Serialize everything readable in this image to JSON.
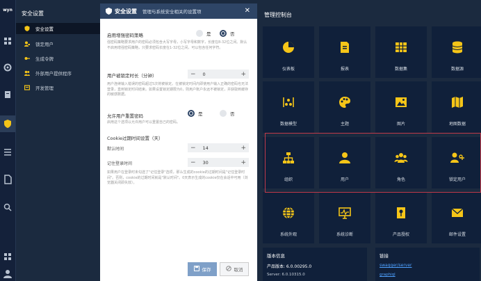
{
  "rail": {
    "logo": "wyn"
  },
  "sidebar": {
    "title": "安全设置",
    "items": [
      {
        "label": "安全设置"
      },
      {
        "label": "锁定用户"
      },
      {
        "label": "生成令牌"
      },
      {
        "label": "外部用户提供程序"
      },
      {
        "label": "开发管理"
      }
    ]
  },
  "dialog": {
    "title": "安全设置",
    "subtitle": "管理与系统安全相关的设置项",
    "close_glyph": "✕",
    "strict_password": {
      "label": "启用增强密码策略",
      "option_yes": "是",
      "option_no": "否",
      "selected": "否",
      "desc": "强密码策略要求用户的密码必须包含大写字母，小写字母和数字，长度在8-32位之间。默认不启用增强密码策略，只要求密码长度在1-32位之间，可以包含任何字符。"
    },
    "lock_time": {
      "label": "用户被锁定时长（分钟）",
      "value": "0",
      "minus": "−",
      "plus": "+",
      "desc": "用户连续输入错误的密码超过5次将被锁定。在被锁定时间内即使用户输入正确的密码也无法登录，直到锁定时间结束。如果设置锁定期限为0，则用户账户永远不被锁定，并获取到缓存的敏感数据。"
    },
    "allow_reset": {
      "label": "允许用户重置密码",
      "option_yes": "是",
      "option_no": "否",
      "selected": "是",
      "desc": "启用这个选项以允许用户可以重置自己的密码。"
    },
    "cookie": {
      "label": "Cookie过期时间设置（天）",
      "default_label": "默认时间",
      "default_value": "14",
      "remember_label": "记住登录时间",
      "remember_value": "30",
      "minus": "−",
      "plus": "+",
      "desc": "如果用户在登录时未勾选了\"记住登录\"选项，那么生成的cookie的过期时间是\"记住登录时间\"。否则，cookie的过期时间就是\"默认时间\"。0天表示生成的cookie仅在会话中可用（浏览器关闭即失效）。"
    },
    "save_label": "保存",
    "cancel_label": "取消"
  },
  "right": {
    "title": "管理控制台",
    "tiles": [
      {
        "label": "仪表板",
        "icon": "pie-chart-icon"
      },
      {
        "label": "报表",
        "icon": "document-icon"
      },
      {
        "label": "数据集",
        "icon": "grid-icon"
      },
      {
        "label": "数据源",
        "icon": "database-icon"
      },
      {
        "label": "数据模型",
        "icon": "model-icon"
      },
      {
        "label": "主题",
        "icon": "palette-icon"
      },
      {
        "label": "图片",
        "icon": "image-icon"
      },
      {
        "label": "地图数据",
        "icon": "map-icon"
      },
      {
        "label": "组织",
        "icon": "org-icon"
      },
      {
        "label": "用户",
        "icon": "user-icon"
      },
      {
        "label": "角色",
        "icon": "group-icon"
      },
      {
        "label": "锁定用户",
        "icon": "lock-user-icon"
      },
      {
        "label": "系统外观",
        "icon": "globe-icon"
      },
      {
        "label": "系统诊断",
        "icon": "monitor-icon"
      },
      {
        "label": "产品授权",
        "icon": "key-icon"
      },
      {
        "label": "邮件设置",
        "icon": "mail-icon"
      }
    ],
    "version": {
      "title": "版本信息",
      "product_version": "产品版本: 6.0.00295.0",
      "server": "Server: 6.0.10315.0"
    },
    "links": {
      "title": "链接",
      "link1": "swagger/server",
      "link2": "graphiql"
    }
  },
  "colors": {
    "header": "#2e4566",
    "bg": "#1b2a3f",
    "tile": "#10203a",
    "icon": "#f5c518",
    "highlight": "#c0394a"
  }
}
